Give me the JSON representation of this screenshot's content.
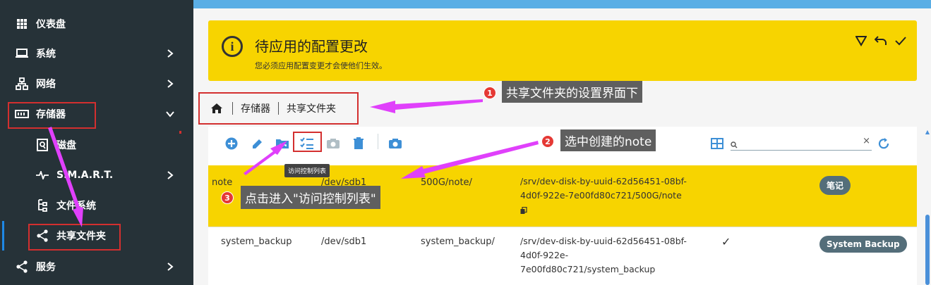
{
  "sidebar": {
    "items": [
      {
        "label": "仪表盘",
        "icon": "grid-icon"
      },
      {
        "label": "系统",
        "icon": "laptop-icon"
      },
      {
        "label": "网络",
        "icon": "network-icon"
      },
      {
        "label": "存储器",
        "icon": "storage-icon"
      },
      {
        "label": "磁盘",
        "icon": "disk-icon"
      },
      {
        "label": "S.M.A.R.T.",
        "icon": "pulse-icon"
      },
      {
        "label": "文件系统",
        "icon": "filesystem-icon"
      },
      {
        "label": "共享文件夹",
        "icon": "share-icon"
      },
      {
        "label": "服务",
        "icon": "share-icon"
      }
    ]
  },
  "notice": {
    "title": "待应用的配置更改",
    "description": "您必须应用配置变更才会使他们生效。"
  },
  "breadcrumb": {
    "items": [
      "存储器",
      "共享文件夹"
    ]
  },
  "toolbar": {
    "tooltip": "访问控制列表",
    "search_placeholder": ""
  },
  "table": {
    "rows": [
      {
        "name": "note",
        "device": "/dev/sdb1",
        "relpath": "500G/note/",
        "abspath": [
          "/srv/dev-disk-by-uuid-62d56451-08bf-",
          "4d0f-922e-7e00fd80c721/500G/note"
        ],
        "referenced": "",
        "tag": "笔记"
      },
      {
        "name": "system_backup",
        "device": "/dev/sdb1",
        "relpath": "system_backup/",
        "abspath": [
          "/srv/dev-disk-by-uuid-62d56451-08bf-",
          "4d0f-922e-",
          "7e00fd80c721/system_backup"
        ],
        "referenced": "✓",
        "tag": "System Backup"
      }
    ]
  },
  "annotations": {
    "step1": {
      "num": "1",
      "text": "共享文件夹的设置界面下"
    },
    "step2": {
      "num": "2",
      "text": "选中创建的note"
    },
    "step3": {
      "num": "3",
      "text": "点击进入\"访问控制列表\""
    }
  },
  "colors": {
    "sidebar_bg": "#263238",
    "notice_bg": "#f7d400",
    "accent_blue": "#1e88e5",
    "annotation_red": "#d32f2f",
    "arrow_magenta": "#e040fb"
  }
}
